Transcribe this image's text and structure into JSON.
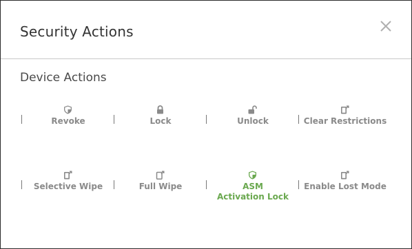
{
  "dialog": {
    "title": "Security Actions",
    "close_icon": "close-icon"
  },
  "section": {
    "title": "Device Actions"
  },
  "colors": {
    "text_muted": "#8a8a8a",
    "icon_gray": "#8a8a8a",
    "active_green": "#6aa84f",
    "border": "#2b2b2b"
  },
  "actions": [
    {
      "label": "Revoke",
      "icon": "shield-icon",
      "active": false
    },
    {
      "label": "Lock",
      "icon": "lock-icon",
      "active": false
    },
    {
      "label": "Unlock",
      "icon": "unlock-icon",
      "active": false
    },
    {
      "label": "Clear Restrictions",
      "icon": "device-arrow-icon",
      "active": false
    },
    {
      "label": "Selective Wipe",
      "icon": "device-arrow-icon",
      "active": false
    },
    {
      "label": "Full Wipe",
      "icon": "device-arrow-outline-icon",
      "active": false
    },
    {
      "label": "ASM\nActivation Lock",
      "label_line1": "ASM",
      "label_line2": "Activation Lock",
      "icon": "shield-icon",
      "active": true
    },
    {
      "label": "Enable Lost Mode",
      "icon": "device-arrow-icon",
      "active": false
    }
  ]
}
